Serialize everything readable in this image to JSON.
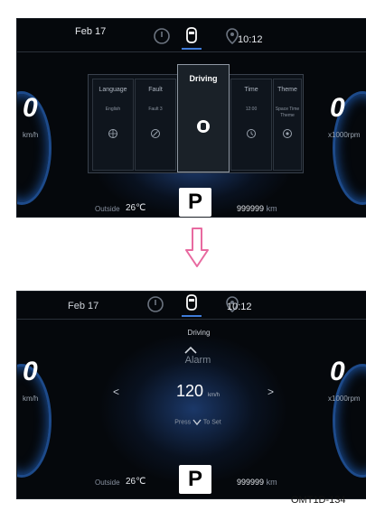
{
  "top_screen": {
    "date": "Feb 17",
    "time": "10:12",
    "speed": "0",
    "speed_unit": "km/h",
    "tach_value": "0",
    "tach_unit": "x1000rpm",
    "menu": [
      {
        "title": "Language",
        "value": "English",
        "icon": "globe-icon"
      },
      {
        "title": "Fault",
        "value": "Fault 3",
        "icon": "fault-icon"
      },
      {
        "title": "Driving",
        "value": "",
        "icon": "car-icon",
        "selected": true
      },
      {
        "title": "Time",
        "value": "12:00",
        "icon": "clock-icon"
      },
      {
        "title": "Theme",
        "value": "Space Time Theme",
        "icon": "theme-icon"
      }
    ],
    "outside_label": "Outside",
    "outside_temp": "26℃",
    "gear": "P",
    "odometer": "999999",
    "odometer_unit": "km"
  },
  "bottom_screen": {
    "date": "Feb 17",
    "time": "10:12",
    "speed": "0",
    "speed_unit": "km/h",
    "tach_value": "0",
    "tach_unit": "x1000rpm",
    "section_title": "Driving",
    "item_title": "Alarm",
    "item_value": "120",
    "item_unit": "km/h",
    "instruction_pre": "Press",
    "instruction_post": "To Set",
    "nav_left": "<",
    "nav_right": ">",
    "outside_label": "Outside",
    "outside_temp": "26℃",
    "gear": "P",
    "odometer": "999999",
    "odometer_unit": "km"
  },
  "caption": "OMT1D-134",
  "colors": {
    "screen_bg": "#05080c",
    "accent_blue": "#1f5bb0",
    "arrow_pink": "#e86aa0",
    "text": "#e6e9ee"
  }
}
